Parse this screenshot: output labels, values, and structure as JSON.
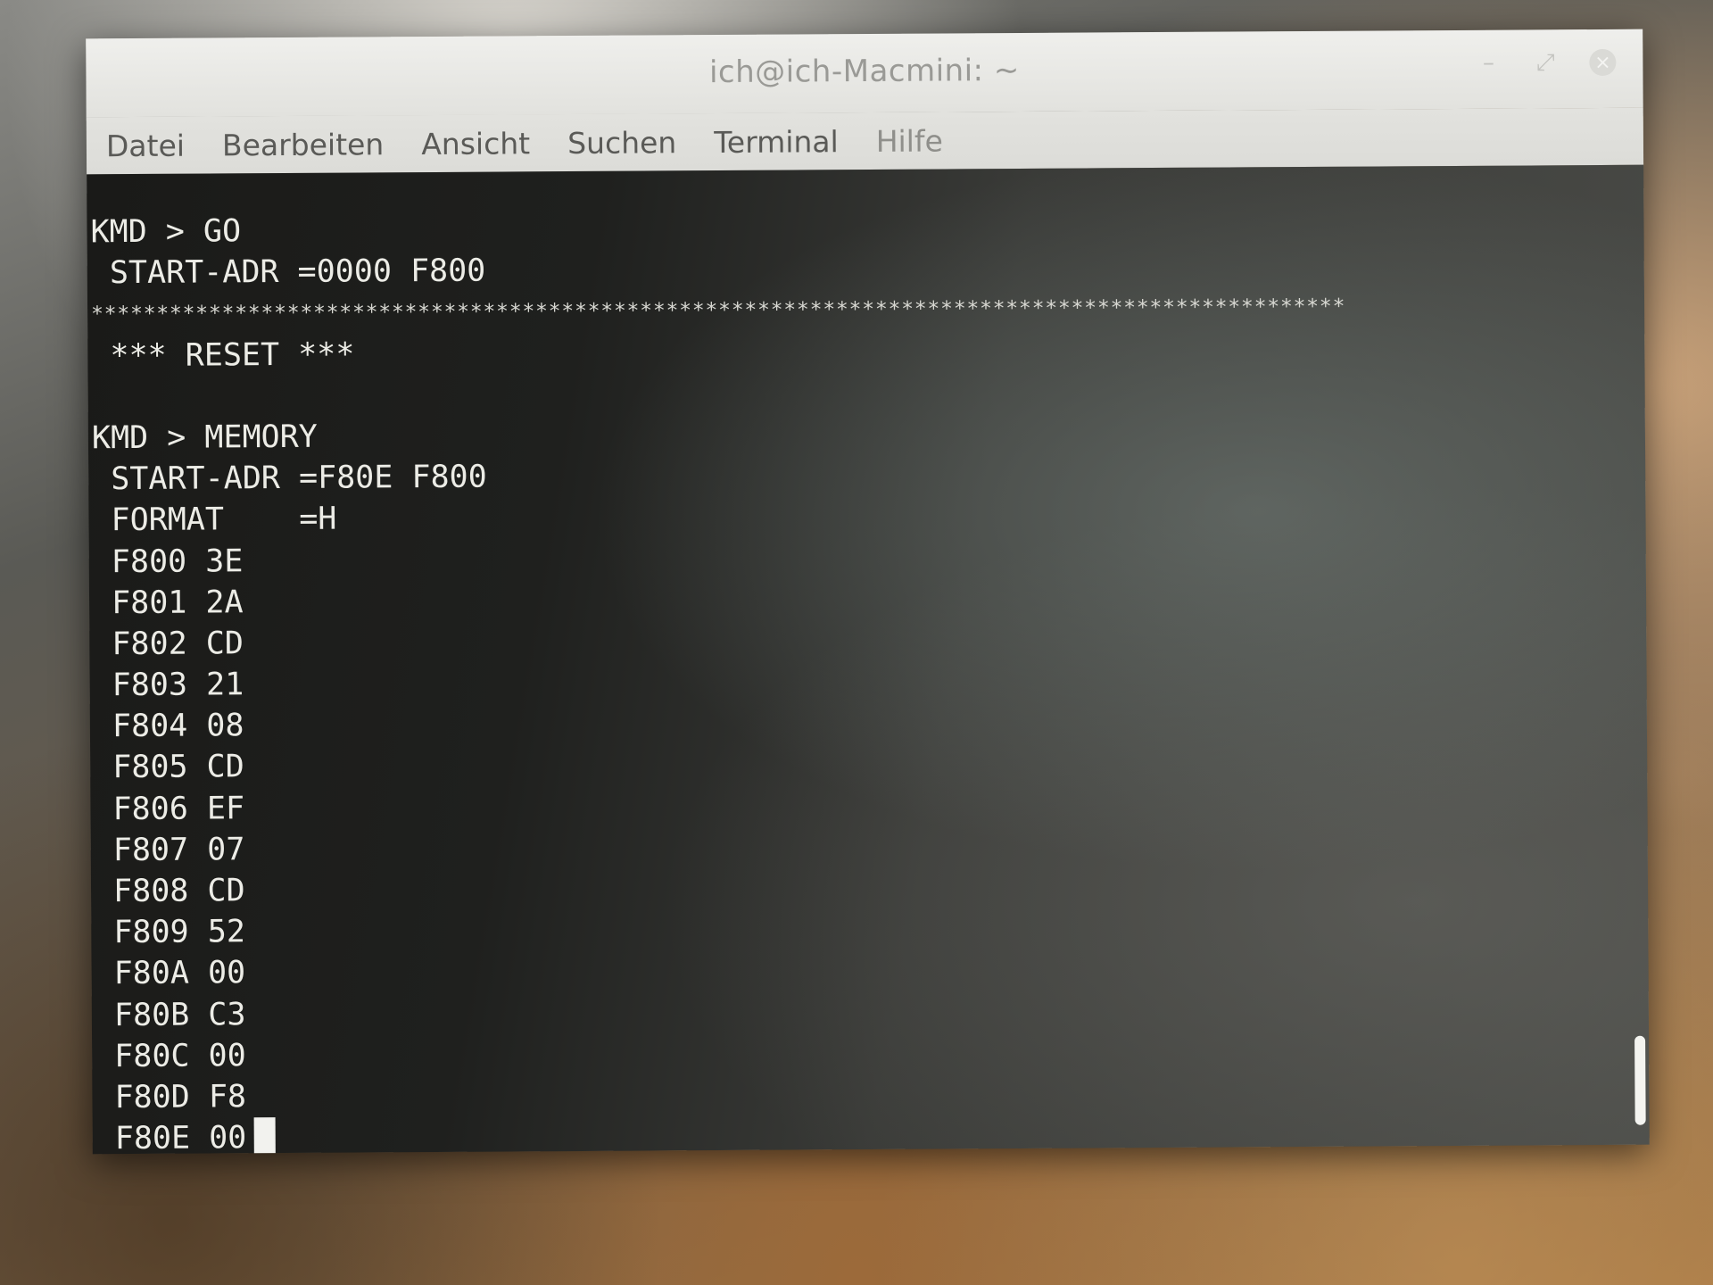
{
  "window": {
    "title": "ich@ich-Macmini: ~",
    "controls": {
      "minimize": "–",
      "maximize": "⤢",
      "close": "×"
    }
  },
  "menubar": {
    "items": [
      {
        "label": "Datei"
      },
      {
        "label": "Bearbeiten"
      },
      {
        "label": "Ansicht"
      },
      {
        "label": "Suchen"
      },
      {
        "label": "Terminal"
      },
      {
        "label": "Hilfe"
      }
    ]
  },
  "terminal": {
    "lines": [
      "KMD > GO",
      " START-ADR =0000 F800",
      "************************************************************************************************",
      " *** RESET ***",
      "",
      "KMD > MEMORY",
      " START-ADR =F80E F800",
      " FORMAT    =H",
      " F800 3E",
      " F801 2A",
      " F802 CD",
      " F803 21",
      " F804 08",
      " F805 CD",
      " F806 EF",
      " F807 07",
      " F808 CD",
      " F809 52",
      " F80A 00",
      " F80B C3",
      " F80C 00",
      " F80D F8",
      " F80E 00"
    ]
  },
  "colors": {
    "terminal_text": "#ecece6",
    "terminal_bg": "#1f201e",
    "titlebar_bg": "#e6e6e2"
  }
}
